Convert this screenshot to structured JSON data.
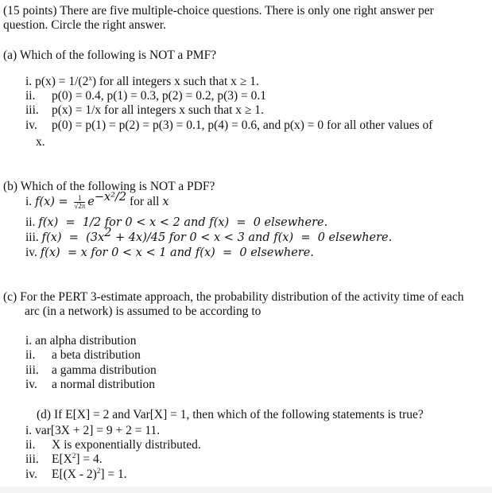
{
  "intro": {
    "line1": "(15 points) There are five multiple-choice questions. There is only one right answer per",
    "line2": "question. Circle the right answer."
  },
  "questions": {
    "a": {
      "label": "(a)",
      "text": "Which of the following is NOT a PMF?",
      "options": [
        {
          "label": "i.",
          "text_pre": "p(x) = 1/(2",
          "sup": "x",
          "text_post": ") for all integers x such that x ≥ 1."
        },
        {
          "label": "ii.",
          "text": "p(0) = 0.4, p(1) = 0.3, p(2) = 0.2, p(3) = 0.1"
        },
        {
          "label": "iii.",
          "text": "p(x) = 1/x for all integers x such that x ≥ 1."
        },
        {
          "label": "iv.",
          "text": "p(0) = p(1) = p(2) = p(3) = 0.1, p(4) = 0.6, and p(x) = 0 for all other values of",
          "continuation": "x."
        }
      ]
    },
    "b": {
      "label": "(b)",
      "text": "Which of the following is NOT a PDF?",
      "options": [
        {
          "label": "i.",
          "lhs": "f(x) = ",
          "frac_num": "1",
          "frac_den": "√2π",
          "exp_base": "e",
          "exp_sup": "−x²/2",
          "tail": " for all ",
          "tail_var": "x"
        },
        {
          "label": "ii.",
          "text": "f(x)  =  1/2 for 0 < x < 2 and f(x)  =  0 elsewhere."
        },
        {
          "label": "iii.",
          "text_pre": "f(x)  =  (3x",
          "sup": "2",
          "text_post": " + 4x)/45 for 0 < x < 3 and f(x)  =  0 elsewhere."
        },
        {
          "label": "iv.",
          "text": "f(x)  = x for 0 < x < 1 and f(x)  =  0 elsewhere."
        }
      ]
    },
    "c": {
      "label": "(c)",
      "text_line1": "For the PERT 3-estimate approach, the probability distribution of the activity time of each",
      "text_line2": "arc (in a network) is assumed to be according to",
      "options": [
        {
          "label": "i.",
          "text": "an alpha distribution"
        },
        {
          "label": "ii.",
          "text": "a beta distribution"
        },
        {
          "label": "iii.",
          "text": "a gamma distribution"
        },
        {
          "label": "iv.",
          "text": "a normal distribution"
        }
      ]
    },
    "d": {
      "label": "(d)",
      "text": "If E[X] = 2 and Var[X] = 1, then which of the following statements is true?",
      "options": [
        {
          "label": "i.",
          "text": "var[3X + 2] = 9 + 2 = 11."
        },
        {
          "label": "ii.",
          "text": "X is exponentially distributed."
        },
        {
          "label": "iii.",
          "text_pre": "E[X",
          "sup": "2",
          "text_post": "] = 4."
        },
        {
          "label": "iv.",
          "text_pre": "E[(X - 2)",
          "sup": "2",
          "text_post": "] = 1."
        }
      ]
    }
  }
}
